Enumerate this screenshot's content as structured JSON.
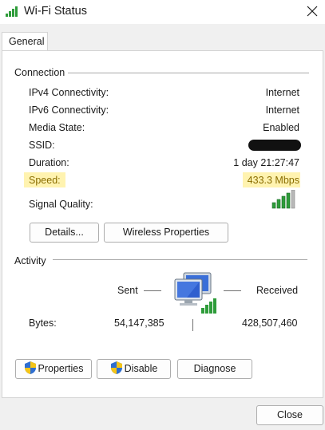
{
  "window": {
    "title": "Wi-Fi Status",
    "title_icon": "wifi-signal-icon",
    "close_icon": "close-icon"
  },
  "tabs": [
    {
      "label": "General",
      "selected": true
    }
  ],
  "connection": {
    "heading": "Connection",
    "rows": [
      {
        "label": "IPv4 Connectivity:",
        "value": "Internet"
      },
      {
        "label": "IPv6 Connectivity:",
        "value": "Internet"
      },
      {
        "label": "Media State:",
        "value": "Enabled"
      },
      {
        "label": "SSID:",
        "value": ""
      },
      {
        "label": "Duration:",
        "value": "1 day 21:27:47"
      },
      {
        "label": "Speed:",
        "value": "433.3 Mbps"
      }
    ],
    "signal_label": "Signal Quality:",
    "signal_icon": "signal-bars-icon",
    "signal_level": 1.0,
    "details_button": "Details...",
    "wireless_button": "Wireless Properties",
    "highlight_color": "#fff3b0",
    "speed_text_color": "#8a6d00"
  },
  "activity": {
    "heading": "Activity",
    "sent_label": "Sent",
    "received_label": "Received",
    "network_icon": "network-computers-icon",
    "bytes_label": "Bytes:",
    "bytes_sent": "54,147,385",
    "bytes_received": "428,507,460"
  },
  "actions": {
    "properties": "Properties",
    "disable": "Disable",
    "diagnose": "Diagnose",
    "shield_icon": "uac-shield-icon"
  },
  "footer": {
    "close_button": "Close"
  }
}
